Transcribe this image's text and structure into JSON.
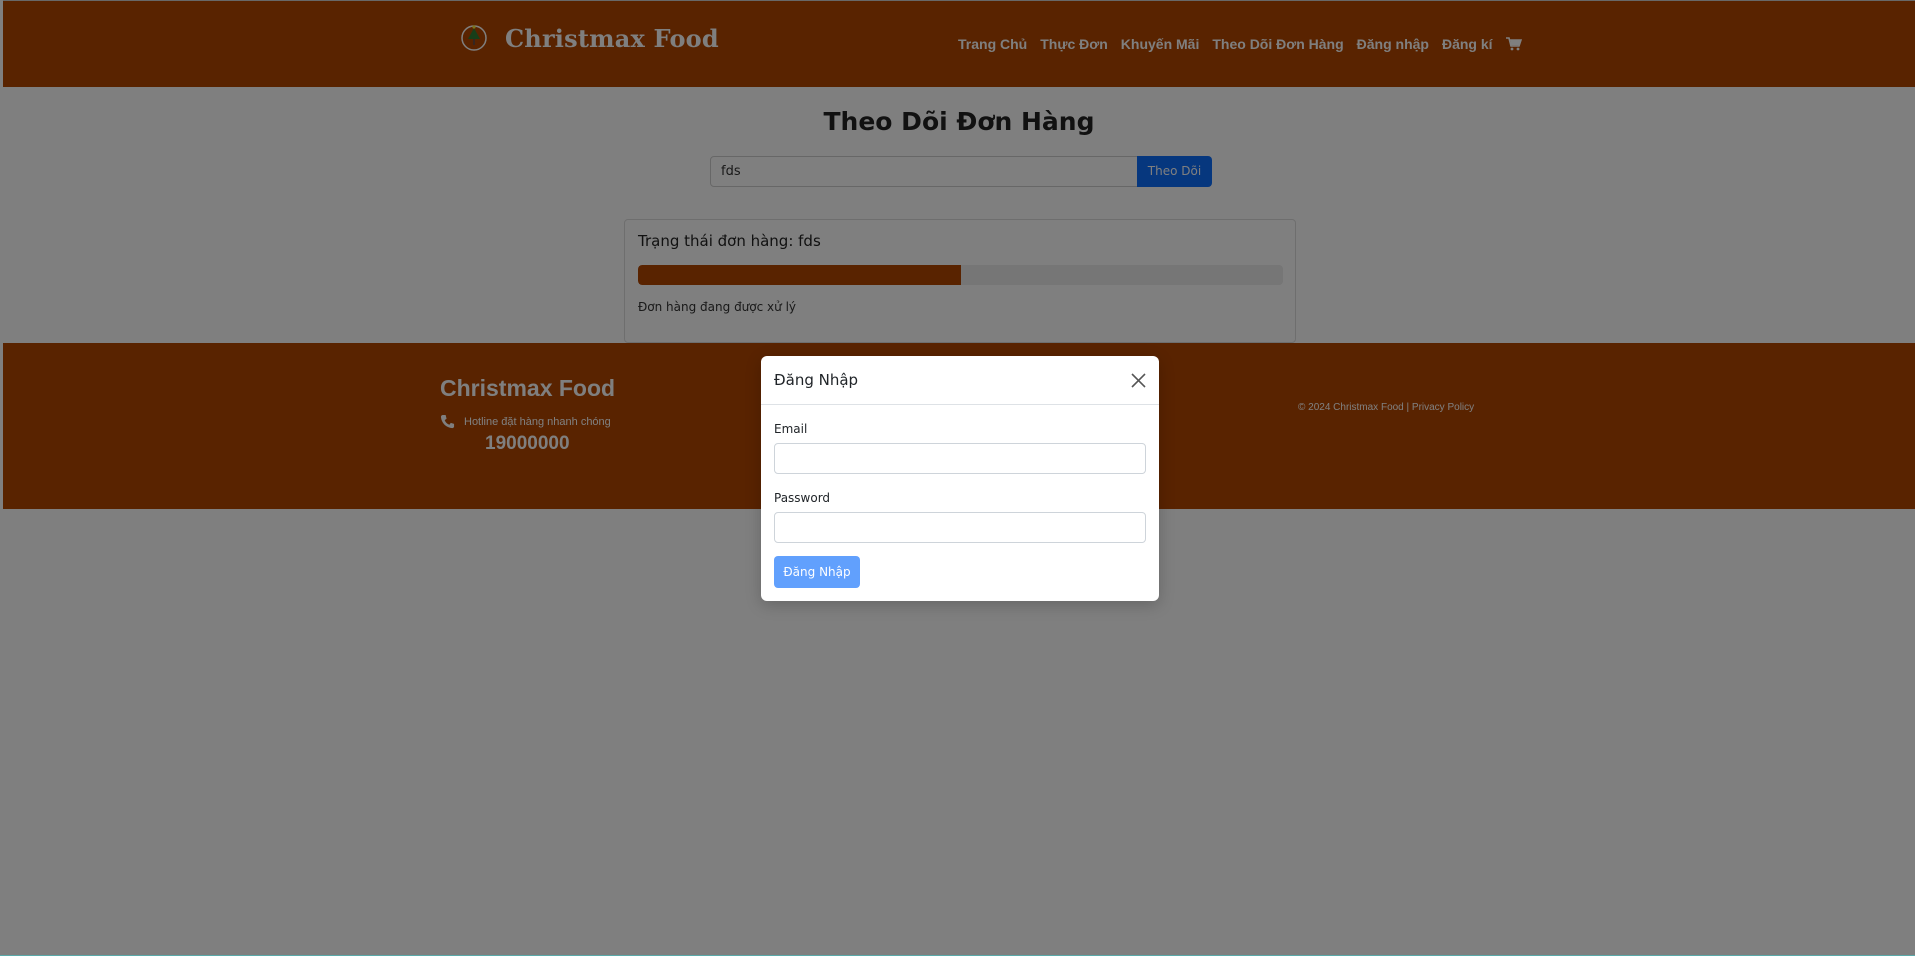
{
  "header": {
    "brand": "Christmax Food",
    "nav": [
      "Trang Chủ",
      "Thực Đơn",
      "Khuyến Mãi",
      "Theo Dõi Đơn Hàng",
      "Đăng nhập",
      "Đăng kí"
    ],
    "cart_icon": "cart-icon",
    "logo_icon": "christmas-tree-logo-icon"
  },
  "main": {
    "title": "Theo Dõi Đơn Hàng",
    "search_value": "fds",
    "search_button": "Theo Dõi",
    "status_title": "Trạng thái đơn hàng: fds",
    "progress_fraction": 0.5,
    "status_text": "Đơn hàng đang được xử lý"
  },
  "footer": {
    "title": "Christmax Food",
    "hotline_label": "Hotline đặt hàng nhanh chóng",
    "phone": "19000000",
    "copyright": "© 2024 Christmax Food | Privacy Policy",
    "phone_icon": "phone-icon"
  },
  "modal": {
    "title": "Đăng Nhập",
    "email_label": "Email",
    "email_value": "",
    "password_label": "Password",
    "password_value": "",
    "submit_label": "Đăng Nhập",
    "close_icon": "close-icon"
  },
  "colors": {
    "brand_orange": "#b34700",
    "primary_blue": "#0d6efd",
    "overlay": "rgba(0,0,0,0.5)"
  }
}
